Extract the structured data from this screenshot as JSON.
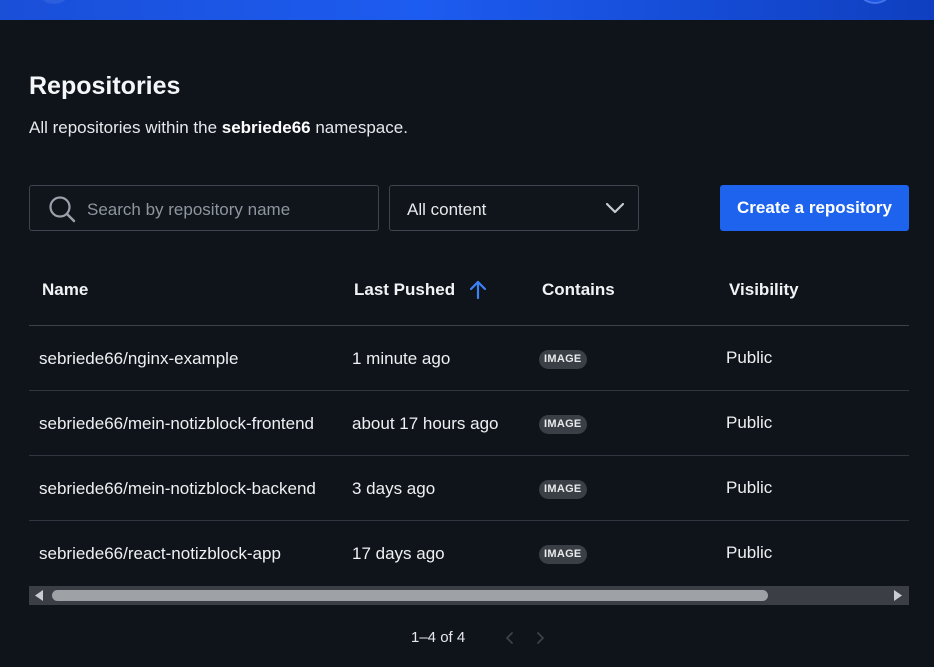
{
  "header": {
    "title": "Repositories",
    "subtitle_prefix": "All repositories within the ",
    "namespace": "sebriede66",
    "subtitle_suffix": " namespace."
  },
  "toolbar": {
    "search_placeholder": "Search by repository name",
    "filter_selected": "All content",
    "create_label": "Create a repository"
  },
  "table": {
    "columns": [
      "Name",
      "Last Pushed",
      "Contains",
      "Visibility"
    ],
    "sort_column": "Last Pushed",
    "sort_direction": "ascending",
    "rows": [
      {
        "name": "sebriede66/nginx-example",
        "last_pushed": "1 minute ago",
        "contains": "IMAGE",
        "visibility": "Public"
      },
      {
        "name": "sebriede66/mein-notizblock-frontend",
        "last_pushed": "about 17 hours ago",
        "contains": "IMAGE",
        "visibility": "Public"
      },
      {
        "name": "sebriede66/mein-notizblock-backend",
        "last_pushed": "3 days ago",
        "contains": "IMAGE",
        "visibility": "Public"
      },
      {
        "name": "sebriede66/react-notizblock-app",
        "last_pushed": "17 days ago",
        "contains": "IMAGE",
        "visibility": "Public"
      }
    ]
  },
  "pagination": {
    "label": "1–4 of 4"
  },
  "colors": {
    "background": "#0f141b",
    "accent": "#1d63ed",
    "sort_arrow": "#3b82f6",
    "badge_bg": "#3a3f46"
  },
  "icons": {
    "search": "search-icon",
    "dropdown": "chevron-down-icon",
    "sort": "arrow-up-icon",
    "prev_page": "chevron-left-icon",
    "next_page": "chevron-right-icon"
  }
}
